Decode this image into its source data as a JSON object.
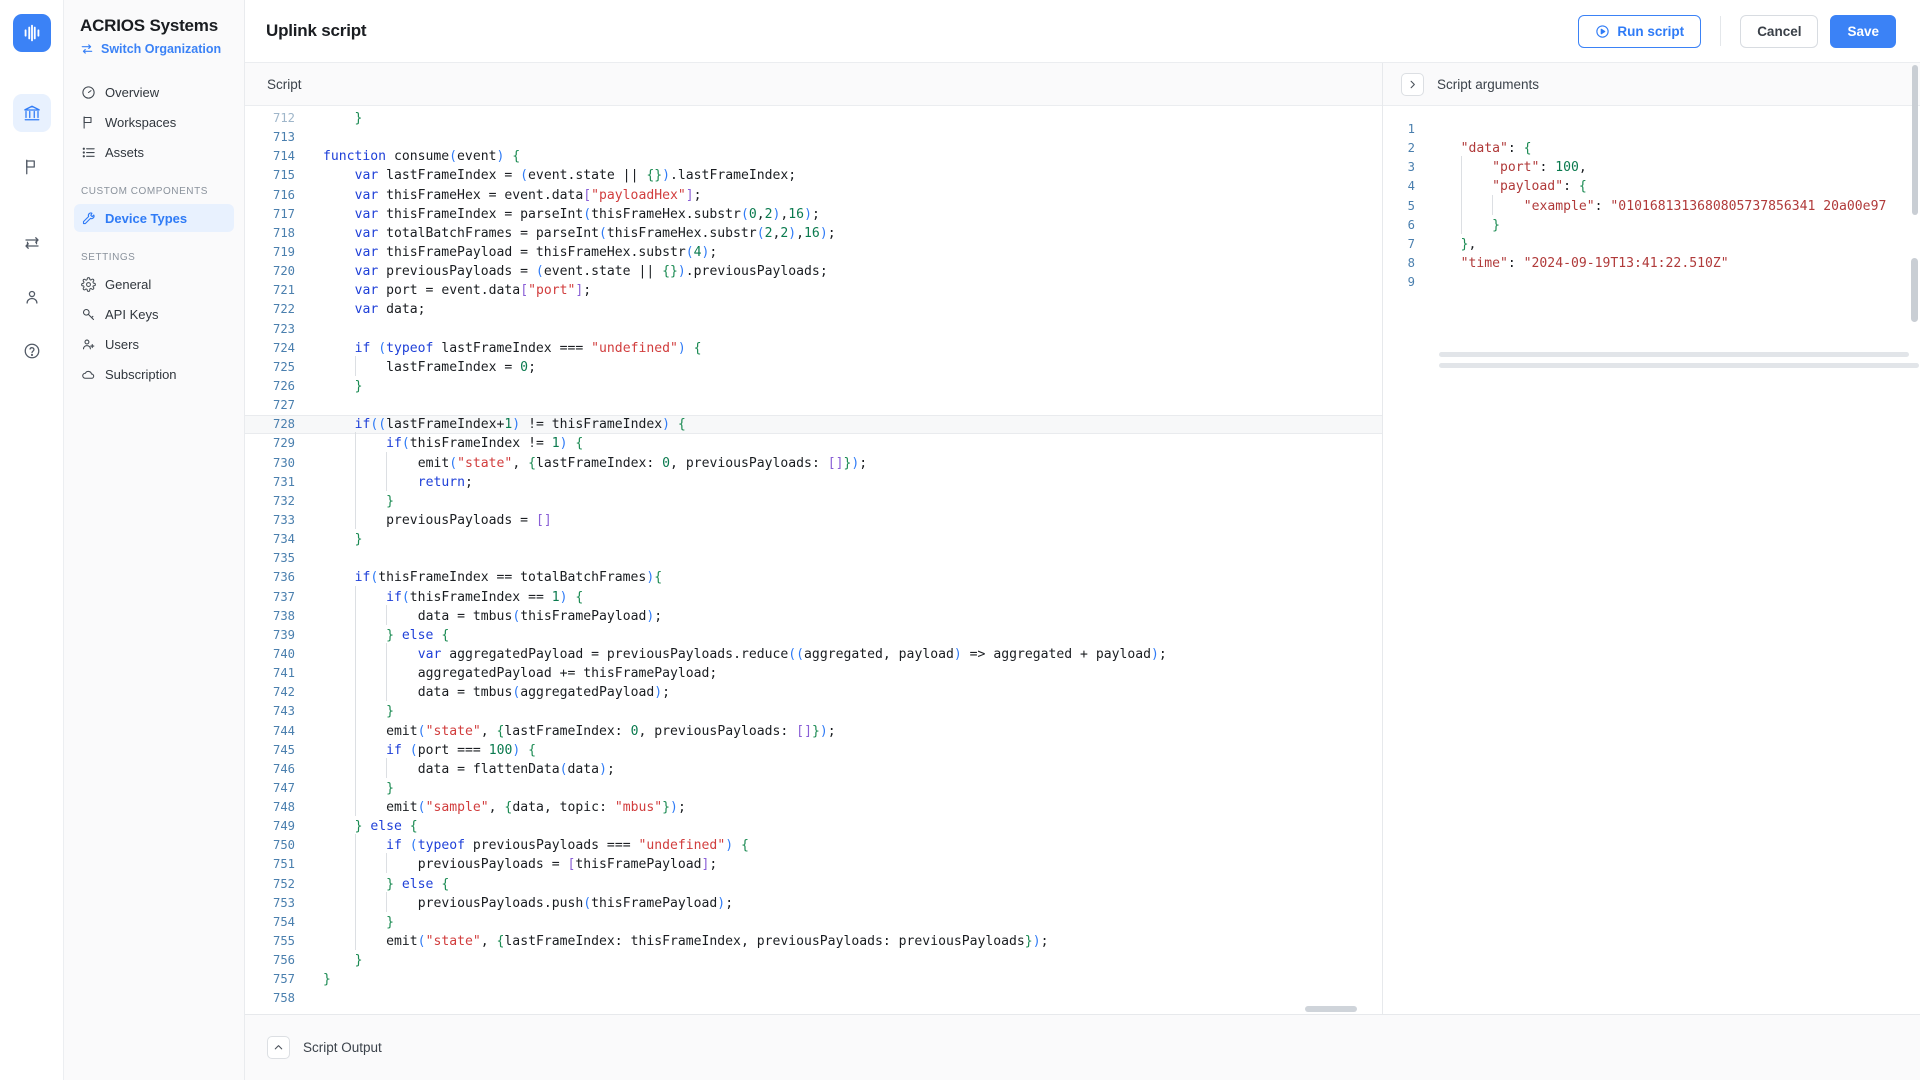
{
  "brand": {
    "logo_icon": "audio-wave-logo",
    "org_name": "ACRIOS Systems",
    "switch_org": "Switch Organization",
    "accent": "#3b82f6"
  },
  "rail": {
    "items": [
      {
        "icon": "bank-icon",
        "name": "overview-rail",
        "active": true
      },
      {
        "icon": "flag-icon",
        "name": "workspaces-rail",
        "active": false
      },
      {
        "icon": "sync-icon",
        "name": "integrations-rail",
        "active": false
      },
      {
        "icon": "user-icon",
        "name": "account-rail",
        "active": false
      },
      {
        "icon": "help-circle-icon",
        "name": "help-rail",
        "active": false
      }
    ]
  },
  "sidebar": {
    "items": [
      {
        "label": "Overview",
        "icon": "gauge-icon",
        "active": false
      },
      {
        "label": "Workspaces",
        "icon": "flag-icon",
        "active": false
      },
      {
        "label": "Assets",
        "icon": "list-icon",
        "active": false
      }
    ],
    "section_custom": "CUSTOM COMPONENTS",
    "custom_items": [
      {
        "label": "Device Types",
        "icon": "wrench-icon",
        "active": true
      }
    ],
    "section_settings": "SETTINGS",
    "settings_items": [
      {
        "label": "General",
        "icon": "gear-icon",
        "active": false
      },
      {
        "label": "API Keys",
        "icon": "key-icon",
        "active": false
      },
      {
        "label": "Users",
        "icon": "users-icon",
        "active": false
      },
      {
        "label": "Subscription",
        "icon": "cloud-icon",
        "active": false
      }
    ]
  },
  "header": {
    "title": "Uplink script",
    "run_label": "Run script",
    "run_icon": "play-circle-icon",
    "cancel_label": "Cancel",
    "save_label": "Save"
  },
  "left_pane": {
    "tab_label": "Script"
  },
  "right_pane": {
    "tab_label": "Script arguments",
    "chevron_icon": "chevron-right-icon"
  },
  "bottom": {
    "label": "Script Output",
    "collapse_icon": "chevron-up-icon"
  },
  "editor": {
    "highlight_line": 728,
    "partial_top_line": "712",
    "lines": [
      {
        "n": 713,
        "text": ""
      },
      {
        "n": 714,
        "text": "function consume(event) {"
      },
      {
        "n": 715,
        "text": "    var lastFrameIndex = (event.state || {}).lastFrameIndex;"
      },
      {
        "n": 716,
        "text": "    var thisFrameHex = event.data[\"payloadHex\"];"
      },
      {
        "n": 717,
        "text": "    var thisFrameIndex = parseInt(thisFrameHex.substr(0,2),16);"
      },
      {
        "n": 718,
        "text": "    var totalBatchFrames = parseInt(thisFrameHex.substr(2,2),16);"
      },
      {
        "n": 719,
        "text": "    var thisFramePayload = thisFrameHex.substr(4);"
      },
      {
        "n": 720,
        "text": "    var previousPayloads = (event.state || {}).previousPayloads;"
      },
      {
        "n": 721,
        "text": "    var port = event.data[\"port\"];"
      },
      {
        "n": 722,
        "text": "    var data;"
      },
      {
        "n": 723,
        "text": ""
      },
      {
        "n": 724,
        "text": "    if (typeof lastFrameIndex === \"undefined\") {"
      },
      {
        "n": 725,
        "text": "        lastFrameIndex = 0;"
      },
      {
        "n": 726,
        "text": "    }"
      },
      {
        "n": 727,
        "text": ""
      },
      {
        "n": 728,
        "text": "    if((lastFrameIndex+1) != thisFrameIndex) {"
      },
      {
        "n": 729,
        "text": "        if(thisFrameIndex != 1) {"
      },
      {
        "n": 730,
        "text": "            emit(\"state\", {lastFrameIndex: 0, previousPayloads: []});"
      },
      {
        "n": 731,
        "text": "            return;"
      },
      {
        "n": 732,
        "text": "        }"
      },
      {
        "n": 733,
        "text": "        previousPayloads = []"
      },
      {
        "n": 734,
        "text": "    }"
      },
      {
        "n": 735,
        "text": ""
      },
      {
        "n": 736,
        "text": "    if(thisFrameIndex == totalBatchFrames){"
      },
      {
        "n": 737,
        "text": "        if(thisFrameIndex == 1) {"
      },
      {
        "n": 738,
        "text": "            data = tmbus(thisFramePayload);"
      },
      {
        "n": 739,
        "text": "        } else {"
      },
      {
        "n": 740,
        "text": "            var aggregatedPayload = previousPayloads.reduce((aggregated, payload) => aggregated + payload);"
      },
      {
        "n": 741,
        "text": "            aggregatedPayload += thisFramePayload;"
      },
      {
        "n": 742,
        "text": "            data = tmbus(aggregatedPayload);"
      },
      {
        "n": 743,
        "text": "        }"
      },
      {
        "n": 744,
        "text": "        emit(\"state\", {lastFrameIndex: 0, previousPayloads: []});"
      },
      {
        "n": 745,
        "text": "        if (port === 100) {"
      },
      {
        "n": 746,
        "text": "            data = flattenData(data);"
      },
      {
        "n": 747,
        "text": "        }"
      },
      {
        "n": 748,
        "text": "        emit(\"sample\", {data, topic: \"mbus\"});"
      },
      {
        "n": 749,
        "text": "    } else {"
      },
      {
        "n": 750,
        "text": "        if (typeof previousPayloads === \"undefined\") {"
      },
      {
        "n": 751,
        "text": "            previousPayloads = [thisFramePayload];"
      },
      {
        "n": 752,
        "text": "        } else {"
      },
      {
        "n": 753,
        "text": "            previousPayloads.push(thisFramePayload);"
      },
      {
        "n": 754,
        "text": "        }"
      },
      {
        "n": 755,
        "text": "        emit(\"state\", {lastFrameIndex: thisFrameIndex, previousPayloads: previousPayloads});"
      },
      {
        "n": 756,
        "text": "    }"
      },
      {
        "n": 757,
        "text": "}"
      },
      {
        "n": 758,
        "text": ""
      }
    ]
  },
  "script_arguments": {
    "lines": [
      {
        "n": 1,
        "text": ""
      },
      {
        "n": 2,
        "text": "    \"data\": {"
      },
      {
        "n": 3,
        "text": "        \"port\": 100,"
      },
      {
        "n": 4,
        "text": "        \"payload\": {"
      },
      {
        "n": 5,
        "text": "            \"example\": \"0101681313680805737856341 20a00e97"
      },
      {
        "n": 6,
        "text": "        }"
      },
      {
        "n": 7,
        "text": "    },"
      },
      {
        "n": 8,
        "text": "    \"time\": \"2024-09-19T13:41:22.510Z\""
      },
      {
        "n": 9,
        "text": ""
      }
    ]
  }
}
